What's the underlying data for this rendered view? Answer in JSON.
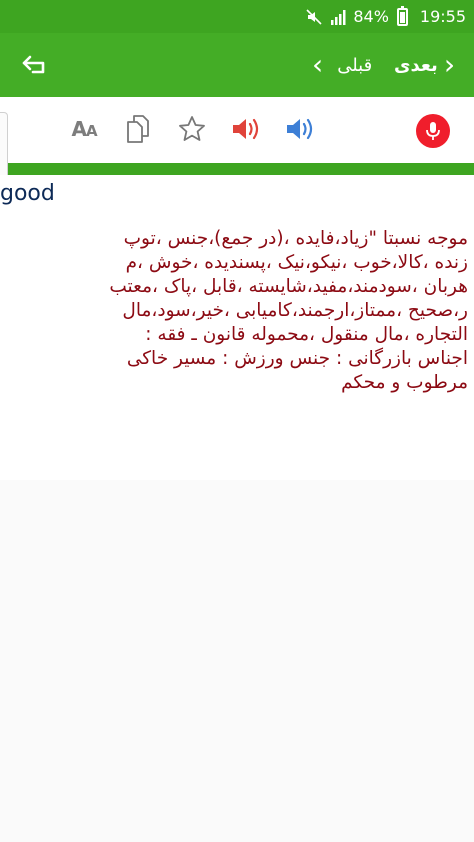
{
  "status_bar": {
    "battery": "84%",
    "time": "19:55",
    "icons": [
      "mute-icon",
      "signal-icon",
      "battery-icon"
    ]
  },
  "app_bar": {
    "back_icon": "return-arrow-icon",
    "prev_label": "قبلی",
    "next_label": "بعدی",
    "background": "#44ad26"
  },
  "toolbar": {
    "font_size_label_big": "A",
    "font_size_label_small": "A",
    "icons": [
      "font-size-icon",
      "copy-icon",
      "star-icon",
      "speaker-uk-icon",
      "speaker-us-icon",
      "mic-icon"
    ]
  },
  "entry": {
    "word": "good",
    "meaning_lines": [
      "موجه نسبتا \"زیاد،فایده ،(در جمع)،جنس ،توپ",
      "زنده ،کالا،خوب ،نیکو،نیک ،پسندیده ،خوش ،م",
      "هربان ،سودمند،مفید،شایسته ،قابل ،پاک ،معتب",
      "ر،صحیح ،ممتاز،ارجمند،کامیابی ،خیر،سود،مال",
      "التجاره ،مال منقول ،محموله قانون ـ فقه :",
      "اجناس بازرگانی : جنس ورزش : مسیر خاکی",
      "مرطوب و محکم"
    ],
    "meaning_color": "#8c0a13",
    "word_color": "#0d2a57"
  }
}
